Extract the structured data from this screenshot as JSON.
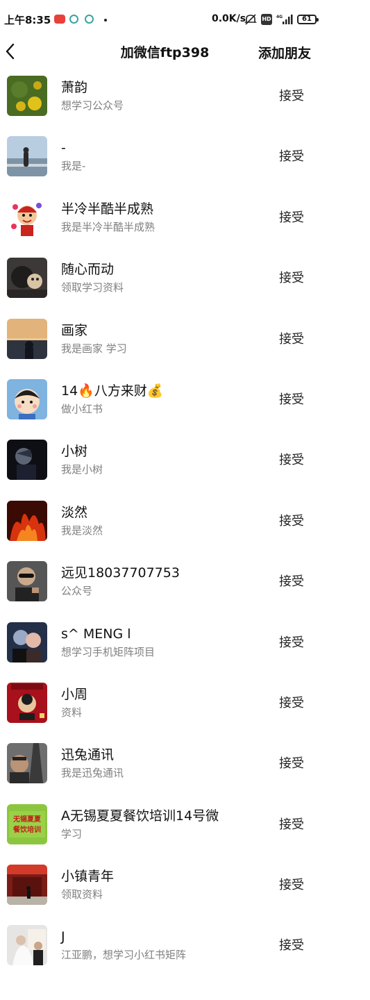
{
  "status_bar": {
    "time": "上午8:35",
    "network_speed": "0.0K/s",
    "hd_label": "HD",
    "network_type": "4G",
    "battery": "61",
    "icons": [
      "notification-app-icon",
      "chat-bubble-icon",
      "chat-bubble-icon",
      "mute-icon",
      "hd-icon",
      "signal-icon",
      "battery-icon"
    ]
  },
  "nav": {
    "back_icon": "chevron-left-icon",
    "title": "加微信ftp398",
    "add_friend_label": "添加朋友"
  },
  "accept_label": "接受",
  "requests": [
    {
      "name": "萧韵",
      "message": "想学习公众号",
      "avatar": "yellow-flowers-photo"
    },
    {
      "name": "-",
      "message": "我是-",
      "avatar": "person-by-lake-photo"
    },
    {
      "name": "半冷半酷半成熟",
      "message": "我是半冷半酷半成熟",
      "avatar": "cartoon-boy-hearts"
    },
    {
      "name": "随心而动",
      "message": "领取学习资料",
      "avatar": "person-with-dog-photo"
    },
    {
      "name": "画家",
      "message": "我是画家 学习",
      "avatar": "sunset-silhouette-photo"
    },
    {
      "name": "14🔥八方来财💰",
      "message": "做小红书",
      "avatar": "cartoon-child-face"
    },
    {
      "name": "小树",
      "message": "我是小树",
      "avatar": "dark-portrait-photo"
    },
    {
      "name": "淡然",
      "message": "我是淡然",
      "avatar": "fire-photo"
    },
    {
      "name": "远见18037707753",
      "message": "公众号",
      "avatar": "sunglasses-man-photo"
    },
    {
      "name": "s^ MENG l",
      "message": "想学习手机矩阵项目",
      "avatar": "couple-photo"
    },
    {
      "name": "小周",
      "message": "资料",
      "avatar": "red-poster-portrait"
    },
    {
      "name": "迅兔通讯",
      "message": "我是迅兔通讯",
      "avatar": "man-with-tower-photo"
    },
    {
      "name": "A无锡夏夏餐饮培训14号微",
      "message": "学习",
      "avatar": "green-text-logo",
      "avatar_text": "无锡夏夏餐饮培训"
    },
    {
      "name": "小镇青年",
      "message": "领取资料",
      "avatar": "red-gate-photo"
    },
    {
      "name": "J",
      "message": "江亚鹏，想学习小红书矩阵",
      "avatar": "wedding-photo"
    }
  ]
}
